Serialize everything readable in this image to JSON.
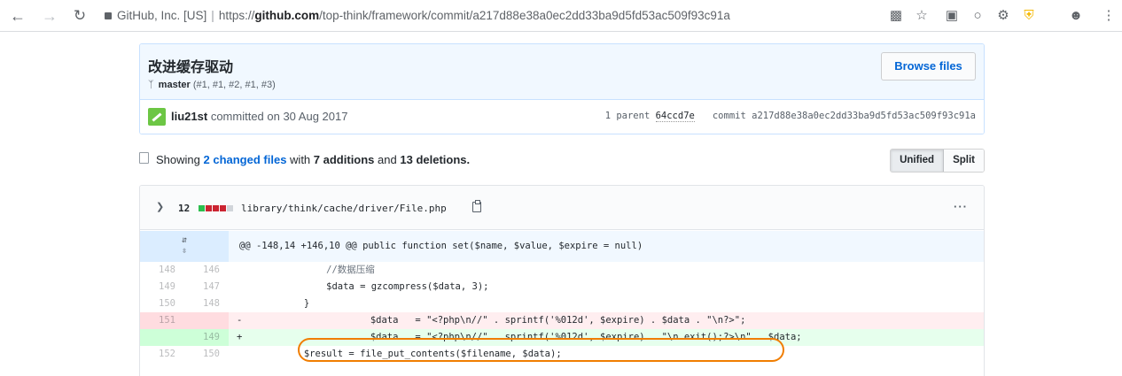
{
  "browser": {
    "org": "GitHub, Inc. [US]",
    "url_prefix": "https://",
    "url_host": "github.com",
    "url_path": "/top-think/framework/commit/a217d88e38a0ec2dd33ba9d5fd53ac509f93c91a",
    "icons": [
      "back-icon",
      "forward-icon",
      "reload-icon",
      "lock-icon",
      "translate-icon",
      "star-icon",
      "bookmark-icon",
      "circle-icon",
      "gear-icon",
      "shield-icon",
      "account-icon",
      "menu-icon"
    ]
  },
  "commit": {
    "title": "改进缓存驱动",
    "branch": "master",
    "refs": "(#1, #1, #2, #1, #3)",
    "browse_label": "Browse files",
    "author": "liu21st",
    "committed_text": "committed on 30 Aug 2017",
    "parent_label": "1 parent",
    "parent_sha": "64ccd7e",
    "commit_label": "commit",
    "commit_sha": "a217d88e38a0ec2dd33ba9d5fd53ac509f93c91a"
  },
  "toc": {
    "showing": "Showing",
    "changed_files": "2 changed files",
    "with": "with",
    "additions": "7 additions",
    "and": "and",
    "deletions": "13 deletions.",
    "unified_label": "Unified",
    "split_label": "Split"
  },
  "file": {
    "change_count": "12",
    "path": "library/think/cache/driver/File.php",
    "more": "···",
    "hunk_header": "@@ -148,14 +146,10 @@ public function set($name, $value, $expire = null)",
    "lines": [
      {
        "old": "148",
        "new": "146",
        "code": "                //数据压缩"
      },
      {
        "old": "149",
        "new": "147",
        "code": "                $data = gzcompress($data, 3);"
      },
      {
        "old": "150",
        "new": "148",
        "code": "            }"
      },
      {
        "old": "151",
        "new": "",
        "marker": "-",
        "code": "            $data   = \"<?php\\n//\" . sprintf('%012d', $expire) . $data . \"\\n?>\";"
      },
      {
        "old": "",
        "new": "149",
        "marker": "+",
        "code": "            $data   = \"<?php\\n//\" . sprintf('%012d', $expire) . \"\\n exit();?>\\n\" . $data;"
      },
      {
        "old": "152",
        "new": "150",
        "code": "            $result = file_put_contents($filename, $data);"
      }
    ]
  },
  "colors": {
    "accent_blue": "#0366d6",
    "add_bg": "#e6ffed",
    "del_bg": "#ffeef0",
    "annotation_orange": "#f07d00"
  }
}
